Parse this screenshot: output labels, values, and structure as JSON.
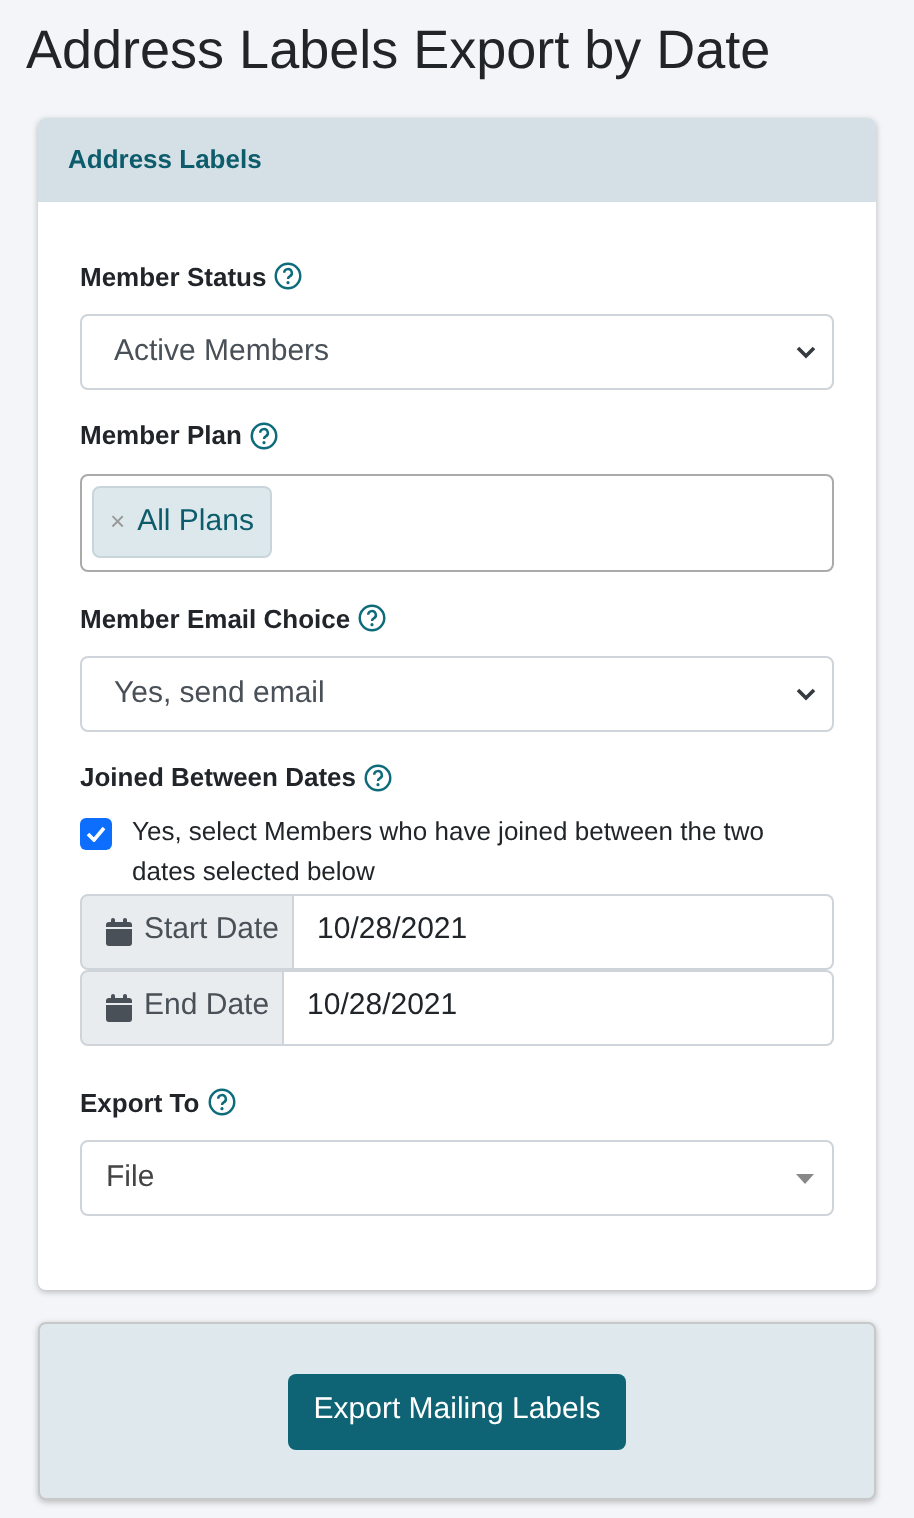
{
  "page_title": "Address Labels Export by Date",
  "panel": {
    "title": "Address Labels",
    "fields": [
      {
        "kind": "select",
        "label": "Member Status",
        "value": "Active Members"
      },
      {
        "kind": "tags",
        "label": "Member Plan",
        "tags": [
          "All Plans"
        ],
        "remove_mark": "×"
      },
      {
        "kind": "select",
        "label": "Member Email Choice",
        "value": "Yes, send email"
      },
      {
        "kind": "dates",
        "label": "Joined Between Dates",
        "checkbox": {
          "checked": true,
          "label": "Yes, select Members who have joined between the two dates selected below"
        },
        "dates": [
          {
            "label": "Start Date",
            "value": "10/28/2021"
          },
          {
            "label": "End Date",
            "value": "10/28/2021"
          }
        ]
      },
      {
        "kind": "combo",
        "label": "Export To",
        "value": "File"
      }
    ]
  },
  "footer": {
    "button": "Export Mailing Labels"
  }
}
